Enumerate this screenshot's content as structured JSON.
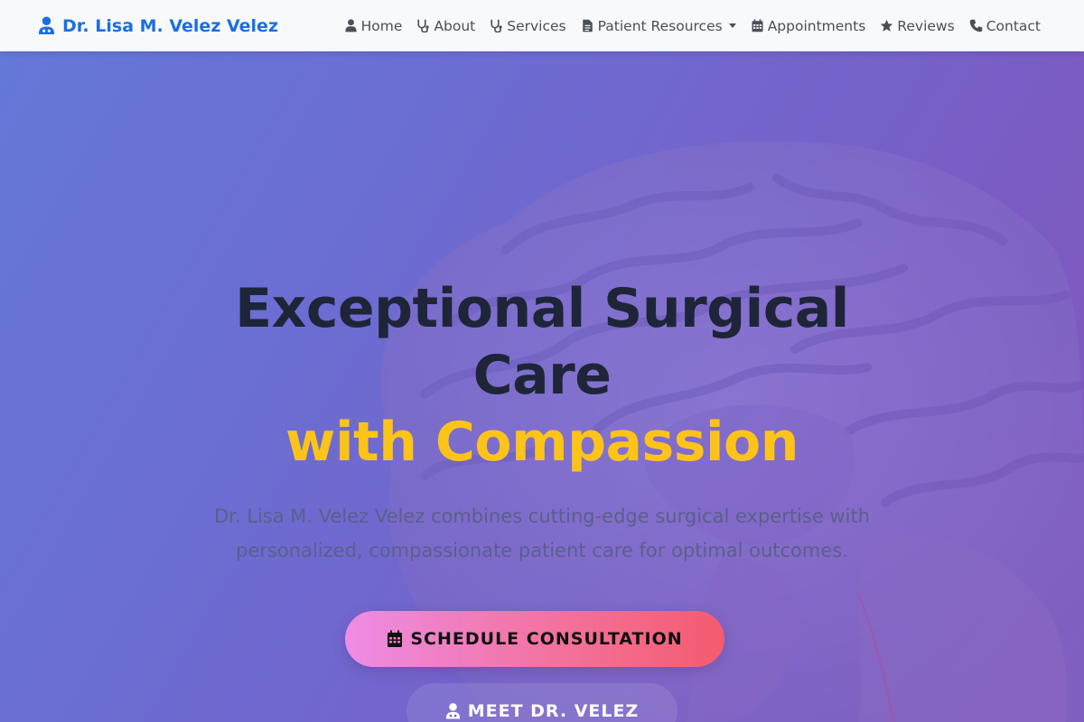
{
  "brand": {
    "name": "Dr. Lisa M. Velez Velez",
    "icon": "user-doctor-icon"
  },
  "nav": {
    "items": [
      {
        "label": "Home",
        "icon": "user-doctor-icon"
      },
      {
        "label": "About",
        "icon": "stethoscope-icon"
      },
      {
        "label": "Services",
        "icon": "stethoscope-icon"
      },
      {
        "label": "Patient Resources",
        "icon": "file-icon",
        "dropdown": true
      },
      {
        "label": "Appointments",
        "icon": "calendar-icon"
      },
      {
        "label": "Reviews",
        "icon": "star-icon"
      },
      {
        "label": "Contact",
        "icon": "phone-icon"
      }
    ]
  },
  "hero": {
    "headline_line1": "Exceptional Surgical",
    "headline_line2": "Care",
    "headline_accent": "with Compassion",
    "subtitle": "Dr. Lisa M. Velez Velez combines cutting-edge surgical expertise with personalized, compassionate patient care for optimal outcomes.",
    "primary_cta": "SCHEDULE CONSULTATION",
    "secondary_cta": "MEET DR. VELEZ"
  },
  "colors": {
    "brand": "#1c6fe0",
    "accent": "#fcc419",
    "headline": "#1e2538",
    "cta_gradient_start": "#ee8ce6",
    "cta_gradient_end": "#f45b6e"
  }
}
